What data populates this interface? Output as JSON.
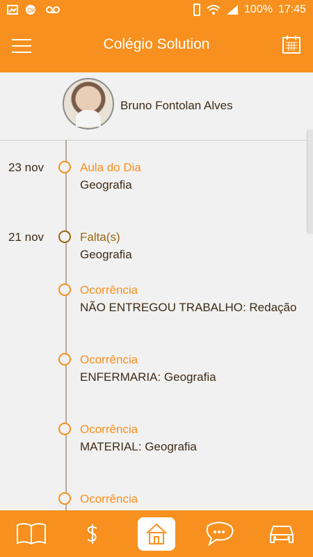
{
  "status_bar": {
    "battery": "100%",
    "time": "17:45"
  },
  "app_bar": {
    "title": "Colégio Solution",
    "menu_icon": "hamburger-menu-icon",
    "calendar_icon": "calendar-icon"
  },
  "profile": {
    "name": "Bruno Fontolan Alves"
  },
  "timeline": [
    {
      "date": "23 nov",
      "title": "Aula do Dia",
      "desc": "Geografia",
      "dark": false
    },
    {
      "date": "21 nov",
      "title": "Falta(s)",
      "desc": "Geografia",
      "dark": true
    },
    {
      "date": "",
      "title": "Ocorrência",
      "desc": "NÃO ENTREGOU TRABALHO: Redação",
      "dark": false
    },
    {
      "date": "",
      "title": "Ocorrência",
      "desc": "ENFERMARIA: Geografia",
      "dark": false
    },
    {
      "date": "",
      "title": "Ocorrência",
      "desc": "MATERIAL: Geografia",
      "dark": false
    },
    {
      "date": "",
      "title": "Ocorrência",
      "desc": "",
      "dark": false
    }
  ],
  "bottom_nav": [
    {
      "name": "book-icon",
      "active": false
    },
    {
      "name": "dollar-icon",
      "active": false
    },
    {
      "name": "home-icon",
      "active": true
    },
    {
      "name": "chat-icon",
      "active": false
    },
    {
      "name": "car-icon",
      "active": false
    }
  ],
  "colors": {
    "accent": "#f7901e",
    "text": "#3d2b17",
    "dark_marker": "#9a650d"
  }
}
